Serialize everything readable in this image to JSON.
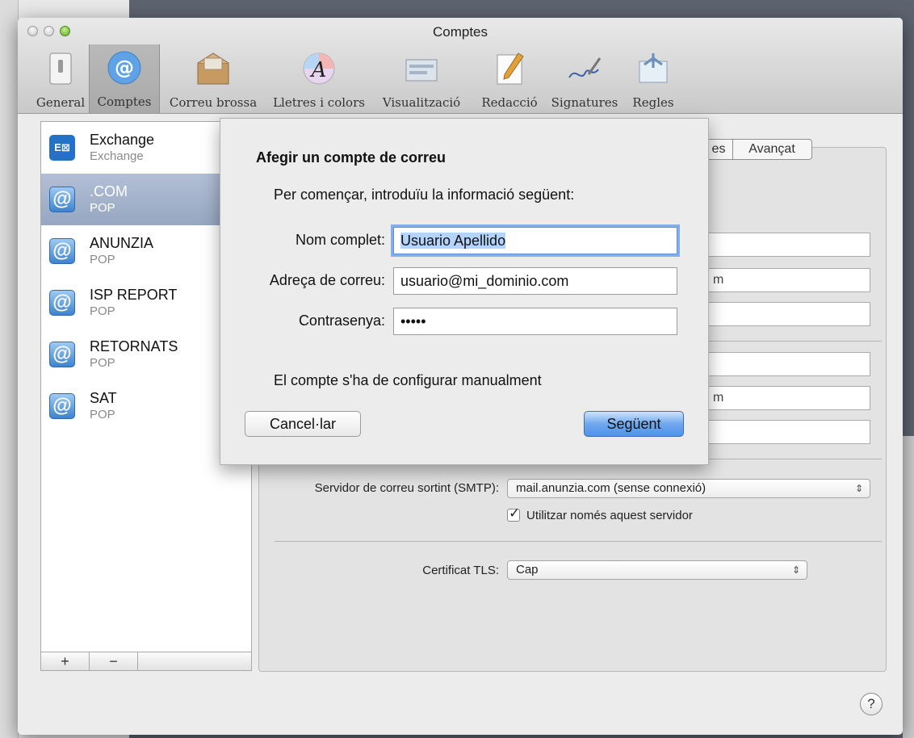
{
  "window": {
    "title": "Comptes"
  },
  "toolbar": {
    "items": [
      {
        "label": "General",
        "icon": "switch-icon"
      },
      {
        "label": "Comptes",
        "icon": "at-sign-icon",
        "active": true
      },
      {
        "label": "Correu brossa",
        "icon": "junk-mail-icon"
      },
      {
        "label": "Lletres i colors",
        "icon": "fonts-colors-icon"
      },
      {
        "label": "Visualització",
        "icon": "viewing-icon"
      },
      {
        "label": "Redacció",
        "icon": "composing-icon"
      },
      {
        "label": "Signatures",
        "icon": "signature-icon"
      },
      {
        "label": "Regles",
        "icon": "rules-icon"
      }
    ]
  },
  "accounts": [
    {
      "name": "Exchange",
      "type": "Exchange",
      "icon": "exchange-icon"
    },
    {
      "name": ".COM",
      "type": "POP",
      "icon": "at-sign-icon",
      "selected": true
    },
    {
      "name": "ANUNZIA",
      "type": "POP",
      "icon": "at-sign-icon"
    },
    {
      "name": "ISP REPORT",
      "type": "POP",
      "icon": "at-sign-icon"
    },
    {
      "name": "RETORNATS",
      "type": "POP",
      "icon": "at-sign-icon"
    },
    {
      "name": "SAT",
      "type": "POP",
      "icon": "at-sign-icon"
    }
  ],
  "list_buttons": {
    "add": "+",
    "remove": "−"
  },
  "panel": {
    "tab_advanced": "Avançat",
    "tab_partial": "es",
    "email_partial": "m",
    "server_field_partial": "m",
    "smtp_label": "Servidor de correu sortint (SMTP):",
    "smtp_value": "mail.anunzia.com (sense connexió)",
    "smtp_only_label": "Utilitzar només aquest servidor",
    "smtp_only_checked": true,
    "tls_label": "Certificat TLS:",
    "tls_value": "Cap"
  },
  "sheet": {
    "title": "Afegir un compte de correu",
    "subtitle": "Per començar, introduïu la informació següent:",
    "full_name_label": "Nom complet:",
    "full_name_value": "Usuario Apellido",
    "email_label": "Adreça de correu:",
    "email_value": "usuario@mi_dominio.com",
    "password_label": "Contrasenya:",
    "password_value": "•••••",
    "note": "El compte s'ha de configurar manualment",
    "cancel_label": "Cancel·lar",
    "next_label": "Següent"
  },
  "help_label": "?",
  "colors": {
    "selection": "#9fb0cc",
    "default_button": "#5b9bec",
    "focus_ring": "#82b0e9"
  }
}
